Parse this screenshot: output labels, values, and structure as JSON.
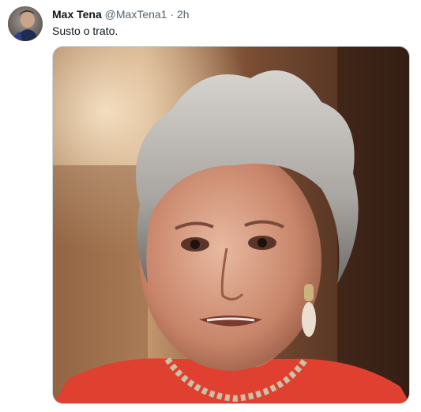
{
  "tweet": {
    "author_name": "Max Tena",
    "author_handle": "@MaxTena1",
    "separator": "·",
    "timestamp": "2h",
    "text": "Susto o trato."
  },
  "icons": {
    "avatar": "profile-avatar",
    "media": "photo-woman-grey-hair"
  },
  "colors": {
    "name": "#0f1419",
    "meta": "#536471",
    "media_border": "#cfd9de",
    "dress": "#e0402f"
  }
}
